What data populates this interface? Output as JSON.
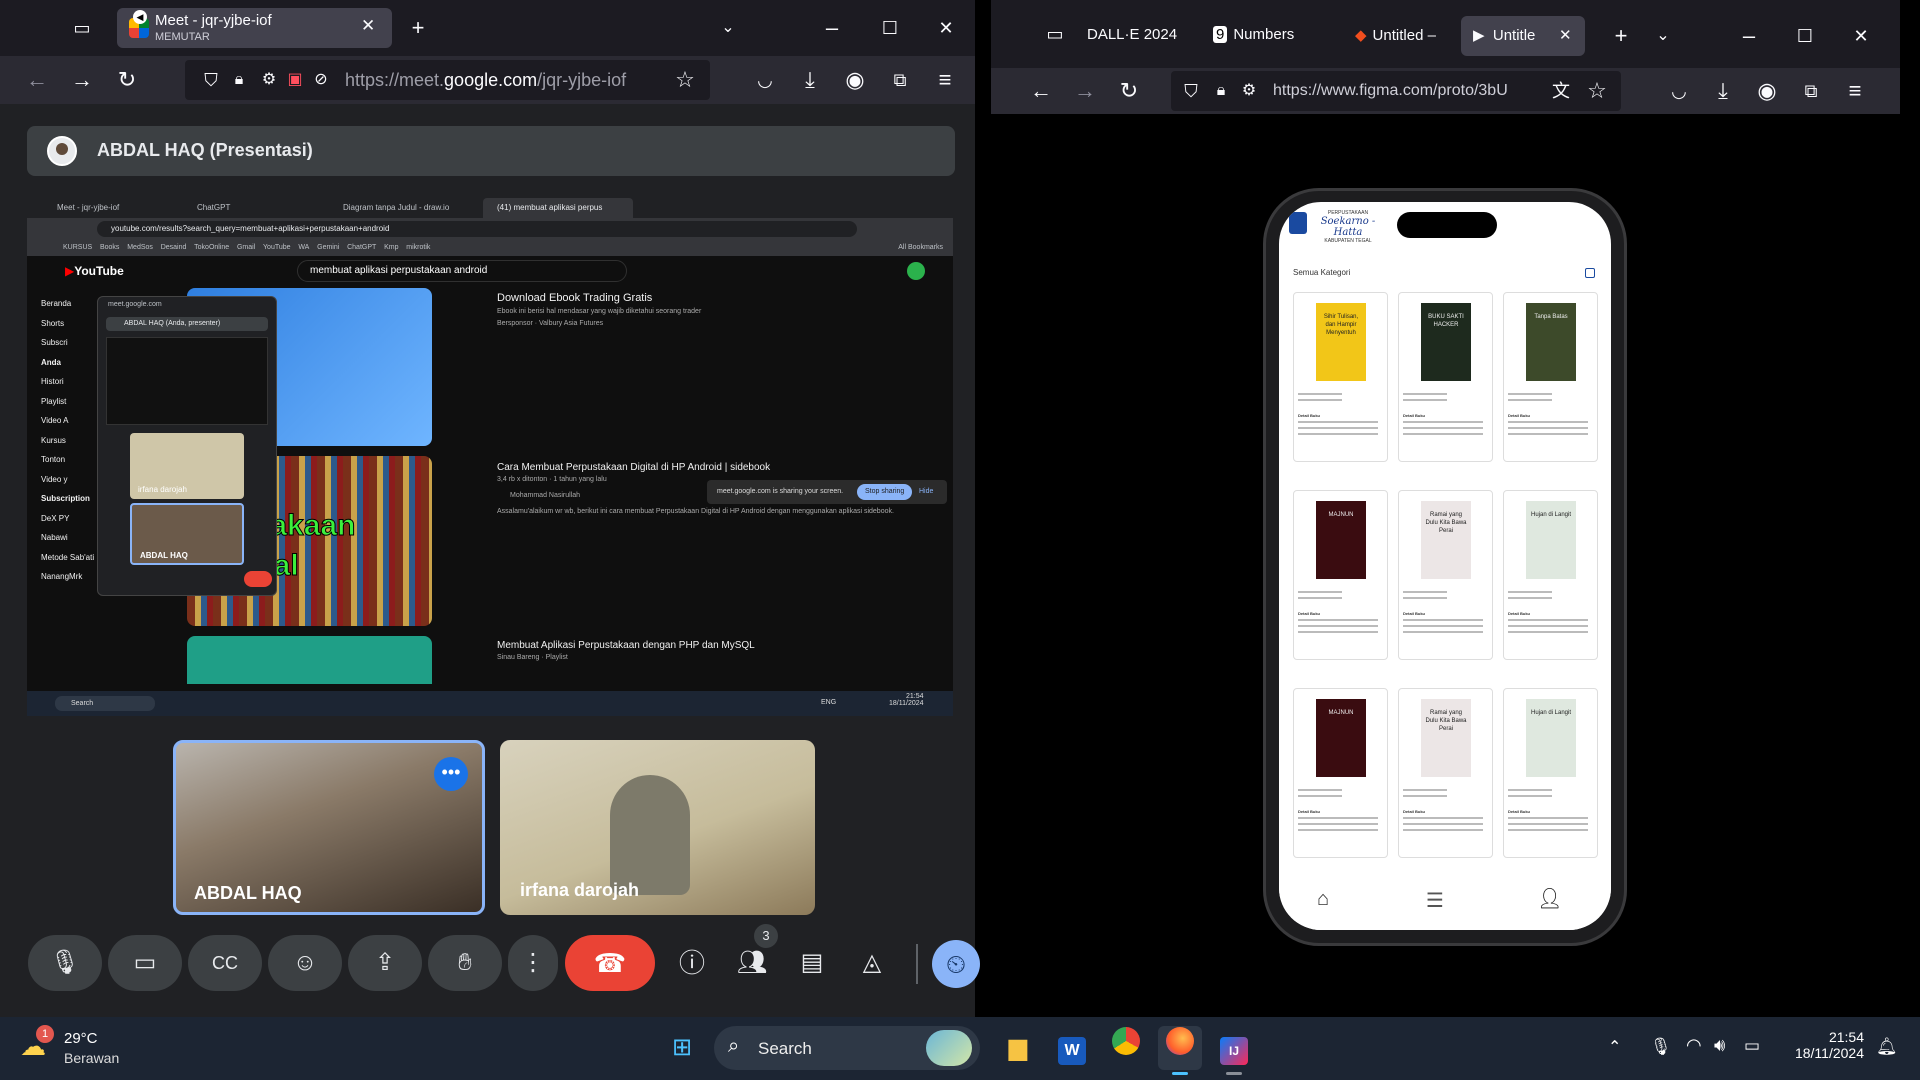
{
  "left_browser": {
    "tab_title": "Meet - jqr-yjbe-iof",
    "tab_subtitle": "MEMUTAR",
    "url_prefix": "https://meet.",
    "url_domain": "google.com",
    "url_suffix": "/jqr-yjbe-iof"
  },
  "meet": {
    "presenter_bar": "ABDAL HAQ (Presentasi)",
    "participants": [
      {
        "name": "ABDAL HAQ"
      },
      {
        "name": "irfana darojah"
      }
    ],
    "people_count": "3"
  },
  "shared_screen": {
    "tabs": [
      "Meet - jqr-yjbe-iof",
      "ChatGPT",
      "Diagram tanpa Judul - draw.io",
      "(41) membuat aplikasi perpus"
    ],
    "url": "youtube.com/results?search_query=membuat+aplikasi+perpustakaan+android",
    "bookmarks": [
      "KURSUS",
      "Books",
      "MedSos",
      "Desaind",
      "TokoOnline",
      "Gmail",
      "YouTube",
      "WA",
      "Gemini",
      "ChatGPT",
      "Kmp",
      "mikrotik",
      "All Bookmarks"
    ],
    "yt_search": "membuat aplikasi perpustakaan android",
    "sidebar": [
      "Beranda",
      "Shorts",
      "Subscri",
      "Anda",
      "Histori",
      "Playlist",
      "Video A",
      "Kursus",
      "Tonton",
      "Video y",
      "Subscription",
      "DeX PY",
      "Nabawi",
      "Metode Sab'ati",
      "NanangMrk"
    ],
    "results": [
      {
        "title": "Download Ebook Trading Gratis",
        "desc": "Ebook ini berisi hal mendasar yang wajib diketahui seorang trader",
        "meta": "Bersponsor · Valbury Asia Futures"
      },
      {
        "title": "Cara Membuat Perpustakaan Digital di HP Android | sidebook",
        "meta": "3,4 rb x ditonton · 1 tahun yang lalu",
        "channel": "Mohammad Nasirullah",
        "desc": "Assalamu'alaikum wr wb, berikut ini cara membuat Perpustakaan Digital di HP Android dengan menggunakan aplikasi sidebook."
      },
      {
        "title": "Membuat Aplikasi Perpustakaan dengan PHP dan MySQL",
        "meta": "Sinau Bareng · Playlist"
      }
    ],
    "thumb2_text": "pustakaan Digital",
    "sharing_msg": "meet.google.com is sharing your screen.",
    "stop_sharing": "Stop sharing",
    "hide": "Hide",
    "pip_url": "meet.google.com",
    "pip_name": "ABDAL HAQ (Anda, presenter)",
    "pip_tiles": [
      "irfana darojah",
      "ABDAL HAQ"
    ],
    "taskbar_search": "Search",
    "clock_time": "21:54",
    "clock_date": "18/11/2024",
    "lang": "ENG"
  },
  "right_browser": {
    "tabs": [
      "DALL·E 2024",
      "Numbers",
      "Untitled –",
      "Untitle"
    ],
    "url": "https://www.figma.com/proto/3bU"
  },
  "phone_app": {
    "header_small": "PERPUSTAKAAN",
    "header_script": "Soekarno - Hatta",
    "header_region": "KABUPATEN TEGAL",
    "section": "Semua Kategori",
    "books": [
      {
        "cover": "Sihir Tulisan, dan Hampir Menyentuh",
        "color": "#f2c618"
      },
      {
        "cover": "BUKU SAKTI HACKER",
        "color": "#1e2a1e"
      },
      {
        "cover": "Tanpa Batas",
        "color": "#3d4a2a"
      },
      {
        "cover": "MAJNUN",
        "color": "#3a0c10"
      },
      {
        "cover": "Ramai yang Dulu Kita Bawa Perai",
        "color": "#ece6e6"
      },
      {
        "cover": "Hujan di Langit",
        "color": "#dfe8df"
      },
      {
        "cover": "MAJNUN",
        "color": "#3a0c10"
      },
      {
        "cover": "Ramai yang Dulu Kita Bawa Perai",
        "color": "#ece6e6"
      },
      {
        "cover": "Hujan di Langit",
        "color": "#dfe8df"
      }
    ],
    "book_label": "Detail Buku"
  },
  "taskbar": {
    "temp": "29°C",
    "weather": "Berawan",
    "badge": "1",
    "search": "Search",
    "time": "21:54",
    "date": "18/11/2024"
  }
}
